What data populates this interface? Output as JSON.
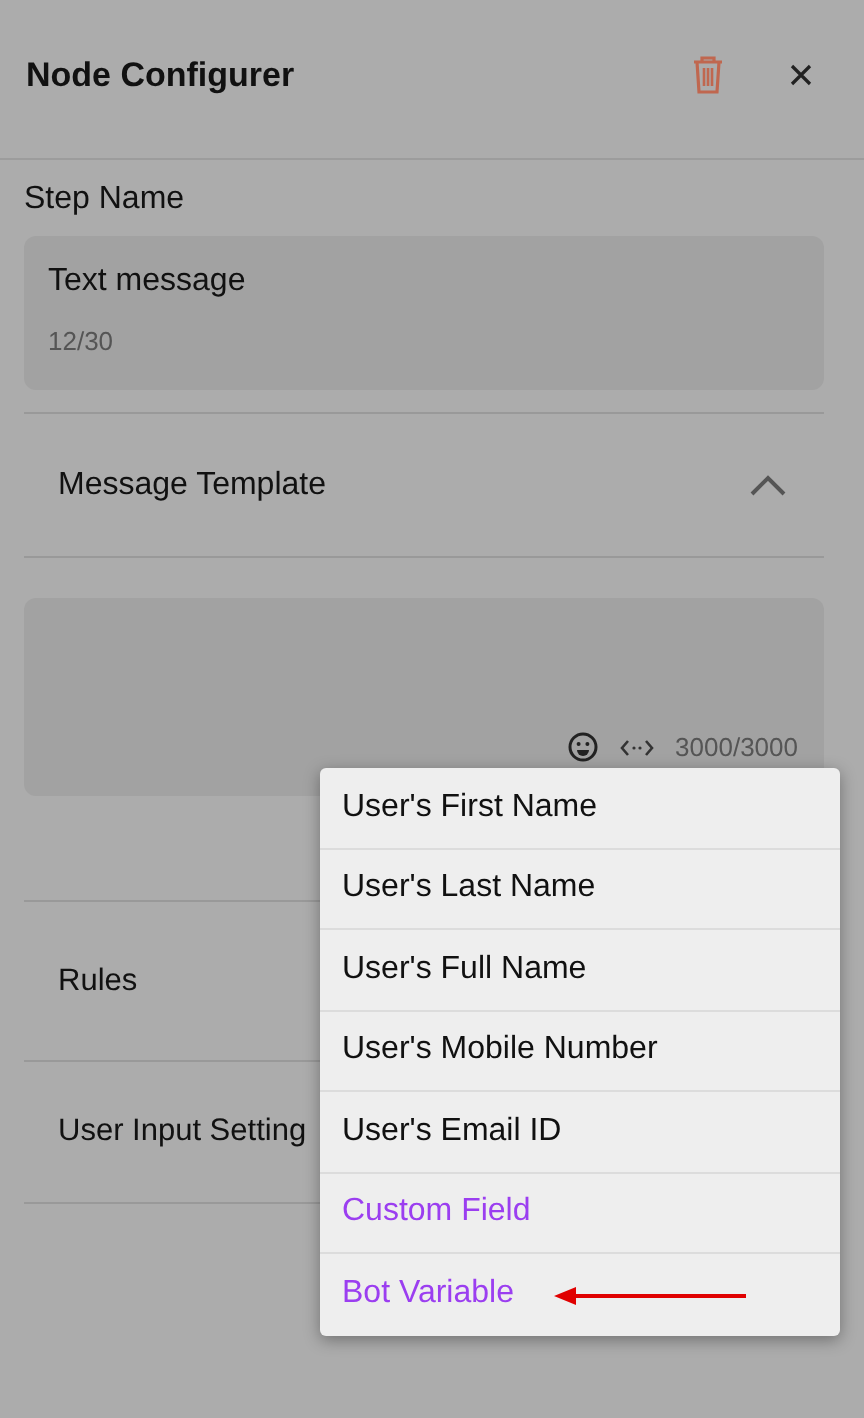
{
  "header": {
    "title": "Node Configurer"
  },
  "step_name": {
    "label": "Step Name",
    "value": "Text message",
    "counter": "12/30"
  },
  "message_template": {
    "title": "Message Template",
    "expanded": true,
    "counter": "3000/3000"
  },
  "sections": [
    {
      "title": "Rules"
    },
    {
      "title": "User Input Setting"
    }
  ],
  "variable_menu": [
    {
      "label": "User's First Name",
      "kind": "standard",
      "annotated": false
    },
    {
      "label": "User's Last Name",
      "kind": "standard",
      "annotated": false
    },
    {
      "label": "User's Full Name",
      "kind": "standard",
      "annotated": false
    },
    {
      "label": "User's Mobile Number",
      "kind": "standard",
      "annotated": false
    },
    {
      "label": "User's Email ID",
      "kind": "standard",
      "annotated": false
    },
    {
      "label": "Custom Field",
      "kind": "special",
      "annotated": false
    },
    {
      "label": "Bot Variable",
      "kind": "special",
      "annotated": true
    }
  ]
}
